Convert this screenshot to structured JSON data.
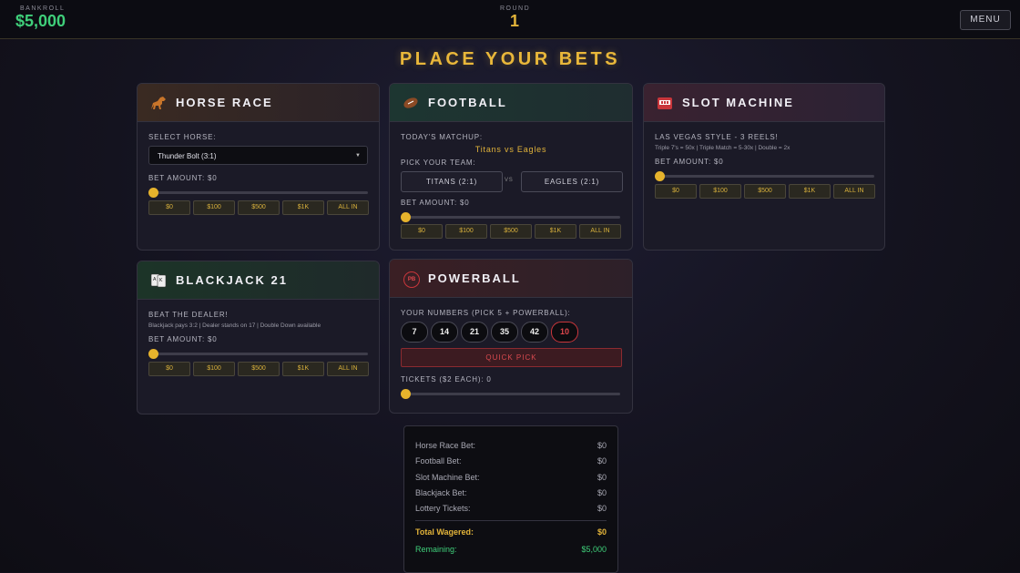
{
  "topbar": {
    "bankroll_label": "BANKROLL",
    "bankroll_value": "$5,000",
    "round_label": "ROUND",
    "round_value": "1",
    "menu_label": "MENU"
  },
  "title": "PLACE YOUR BETS",
  "chip_labels": [
    "$0",
    "$100",
    "$500",
    "$1K",
    "ALL IN"
  ],
  "horse": {
    "title": "HORSE RACE",
    "select_label": "SELECT HORSE:",
    "selected_horse": "Thunder Bolt (3:1)",
    "bet_label": "BET AMOUNT: $0",
    "bet_value": 0
  },
  "football": {
    "title": "FOOTBALL",
    "matchup_label": "TODAY'S MATCHUP:",
    "matchup": "Titans vs Eagles",
    "pick_label": "PICK YOUR TEAM:",
    "team1": "TITANS (2:1)",
    "vs": "VS",
    "team2": "EAGLES (2:1)",
    "bet_label": "BET AMOUNT: $0",
    "bet_value": 0
  },
  "slot": {
    "title": "SLOT MACHINE",
    "subtitle": "LAS VEGAS STYLE - 3 REELS!",
    "payouts": "Triple 7's = 50x | Triple Match = 5-30x | Double = 2x",
    "bet_label": "BET AMOUNT: $0",
    "bet_value": 0
  },
  "blackjack": {
    "title": "BLACKJACK 21",
    "subtitle": "BEAT THE DEALER!",
    "rules": "Blackjack pays 3:2 | Dealer stands on 17 | Double Down available",
    "bet_label": "BET AMOUNT: $0",
    "bet_value": 0
  },
  "powerball": {
    "title": "POWERBALL",
    "icon_text": "PB",
    "numbers_label": "YOUR NUMBERS (PICK 5 + POWERBALL):",
    "numbers": [
      "7",
      "14",
      "21",
      "35",
      "42"
    ],
    "powerball": "10",
    "quick_pick": "QUICK PICK",
    "tickets_label": "TICKETS ($2 EACH): 0",
    "tickets_value": 0
  },
  "summary": {
    "rows": [
      {
        "label": "Horse Race Bet:",
        "value": "$0"
      },
      {
        "label": "Football Bet:",
        "value": "$0"
      },
      {
        "label": "Slot Machine Bet:",
        "value": "$0"
      },
      {
        "label": "Blackjack Bet:",
        "value": "$0"
      },
      {
        "label": "Lottery Tickets:",
        "value": "$0"
      }
    ],
    "total_label": "Total Wagered:",
    "total_value": "$0",
    "remaining_label": "Remaining:",
    "remaining_value": "$5,000"
  },
  "colors": {
    "gold": "#e9b73a",
    "green": "#3fcf7a",
    "red": "#d94a4f"
  },
  "icons": {
    "horse": "horse-icon",
    "football": "football-icon",
    "slot": "slot-machine-icon",
    "blackjack": "playing-cards-icon",
    "powerball": "powerball-icon"
  }
}
